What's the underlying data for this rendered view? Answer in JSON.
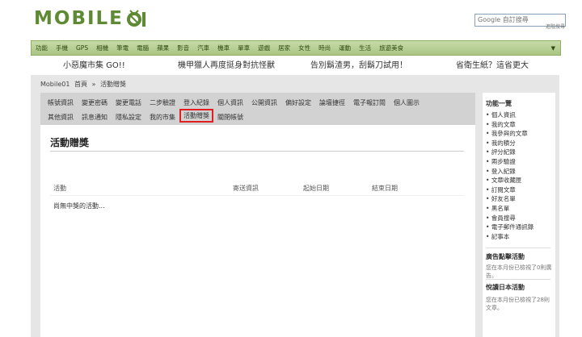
{
  "header": {
    "logo_text": "MOBILE",
    "search": {
      "placeholder": "Google 自訂搜尋",
      "link": "進階搜尋"
    }
  },
  "nav": {
    "items": [
      "功能",
      "手機",
      "GPS",
      "相機",
      "筆電",
      "電腦",
      "蘋果",
      "影音",
      "汽車",
      "機車",
      "單車",
      "遊戲",
      "居家",
      "女性",
      "時尚",
      "運動",
      "生活",
      "旅遊美食"
    ],
    "arrow": "▼"
  },
  "banner": [
    "小惡魔市集 GO!!",
    "機甲獵人再度挺身對抗怪獸",
    "告別鬍渣男，刮鬍刀試用！",
    "省衛生紙？這省更大"
  ],
  "breadcrumb": [
    "Mobile01",
    "首頁",
    "»",
    "活動贈獎"
  ],
  "tabs": {
    "row1": [
      "帳號資訊",
      "變更密碼",
      "變更電話",
      "二步驗證",
      "登入紀錄",
      "個人資訊",
      "公開資訊",
      "偏好設定",
      "論壇捷徑",
      "電子報訂閱",
      "個人圖示"
    ],
    "row2": [
      "其他資訊",
      "訊息通知",
      "隱私設定",
      "我的市集",
      "活動贈獎",
      "關閉帳號"
    ],
    "active": "活動贈獎"
  },
  "main": {
    "title": "活動贈獎",
    "columns": [
      "活動",
      "寄送資訊",
      "起始日期",
      "結束日期"
    ],
    "empty_text": "尚無中獎的活動..."
  },
  "sidebar": {
    "title": "功能一覽",
    "items": [
      "個人資訊",
      "我的文章",
      "我參與的文章",
      "我的積分",
      "評分紀錄",
      "兩步驗證",
      "登入紀錄",
      "文章收藏匣",
      "訂閱文章",
      "好友名單",
      "黑名單",
      "會員搜尋",
      "電子郵件通訊錄",
      "記事本"
    ],
    "ad": {
      "title": "廣告點擊活動",
      "text": "您在本月份已檢視了0則廣告。"
    },
    "japan": {
      "title": "悅讀日本活動",
      "text": "您在本月份已檢視了28則文章。"
    }
  }
}
